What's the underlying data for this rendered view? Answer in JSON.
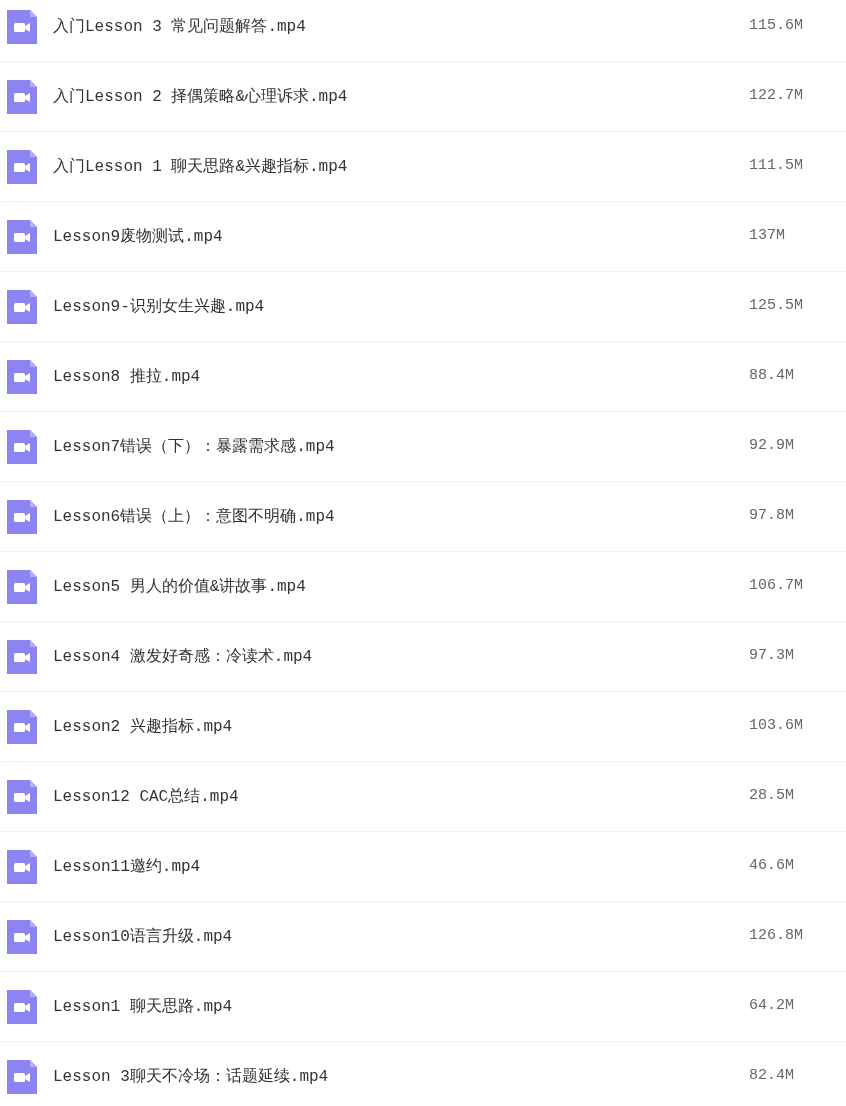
{
  "files": [
    {
      "name": "入门Lesson 3 常见问题解答.mp4",
      "size": "115.6M"
    },
    {
      "name": "入门Lesson 2 择偶策略&心理诉求.mp4",
      "size": "122.7M"
    },
    {
      "name": "入门Lesson 1 聊天思路&兴趣指标.mp4",
      "size": "111.5M"
    },
    {
      "name": "Lesson9废物测试.mp4",
      "size": "137M"
    },
    {
      "name": "Lesson9-识别女生兴趣.mp4",
      "size": "125.5M"
    },
    {
      "name": "Lesson8 推拉.mp4",
      "size": "88.4M"
    },
    {
      "name": "Lesson7错误（下）：暴露需求感.mp4",
      "size": "92.9M"
    },
    {
      "name": "Lesson6错误（上）：意图不明确.mp4",
      "size": "97.8M"
    },
    {
      "name": "Lesson5 男人的价值&讲故事.mp4",
      "size": "106.7M"
    },
    {
      "name": "Lesson4 激发好奇感：冷读术.mp4",
      "size": "97.3M"
    },
    {
      "name": "Lesson2 兴趣指标.mp4",
      "size": "103.6M"
    },
    {
      "name": "Lesson12 CAC总结.mp4",
      "size": "28.5M"
    },
    {
      "name": "Lesson11邀约.mp4",
      "size": "46.6M"
    },
    {
      "name": "Lesson10语言升级.mp4",
      "size": "126.8M"
    },
    {
      "name": "Lesson1 聊天思路.mp4",
      "size": "64.2M"
    },
    {
      "name": "Lesson 3聊天不冷场：话题延续.mp4",
      "size": "82.4M"
    }
  ]
}
